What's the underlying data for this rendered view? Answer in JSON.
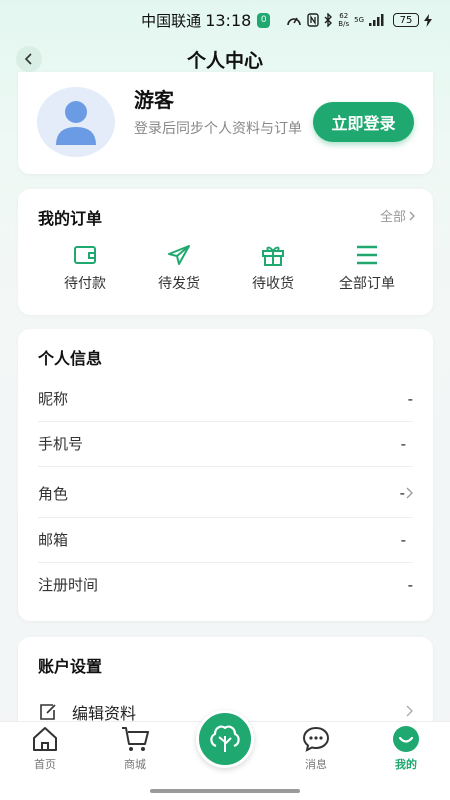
{
  "status_bar": {
    "carrier": "中国联通",
    "time": "13:18",
    "app_badge": "0",
    "net_speed_value": "62",
    "net_speed_unit": "B/s",
    "network": "5G",
    "battery": "75"
  },
  "header": {
    "title": "个人中心",
    "back_icon": "chevron-left-icon"
  },
  "profile": {
    "name": "游客",
    "hint": "登录后同步个人资料与订单",
    "login_label": "立即登录",
    "avatar_icon": "user-avatar-icon"
  },
  "orders": {
    "title": "我的订单",
    "all_label": "全部",
    "items": [
      {
        "label": "待付款",
        "icon": "wallet-icon"
      },
      {
        "label": "待发货",
        "icon": "send-icon"
      },
      {
        "label": "待收货",
        "icon": "gift-icon"
      },
      {
        "label": "全部订单",
        "icon": "menu-icon"
      }
    ]
  },
  "personal_info": {
    "title": "个人信息",
    "rows": [
      {
        "label": "昵称",
        "value": "-"
      },
      {
        "label": "手机号",
        "value": "-"
      },
      {
        "label": "角色",
        "value": "-"
      },
      {
        "label": "邮箱",
        "value": "-"
      },
      {
        "label": "注册时间",
        "value": "-"
      }
    ]
  },
  "account_settings": {
    "title": "账户设置",
    "items": [
      {
        "label": "编辑资料",
        "icon": "edit-icon"
      }
    ]
  },
  "bottom_nav": {
    "items": [
      {
        "label": "首页",
        "icon": "home-icon"
      },
      {
        "label": "商城",
        "icon": "cart-icon"
      },
      {
        "label": "消息",
        "icon": "message-icon"
      },
      {
        "label": "我的",
        "icon": "profile-icon"
      }
    ],
    "center_icon": "tree-icon",
    "active": "我的"
  },
  "colors": {
    "accent": "#1fa870",
    "background": "#eaf7f2",
    "muted_text": "#888888"
  }
}
